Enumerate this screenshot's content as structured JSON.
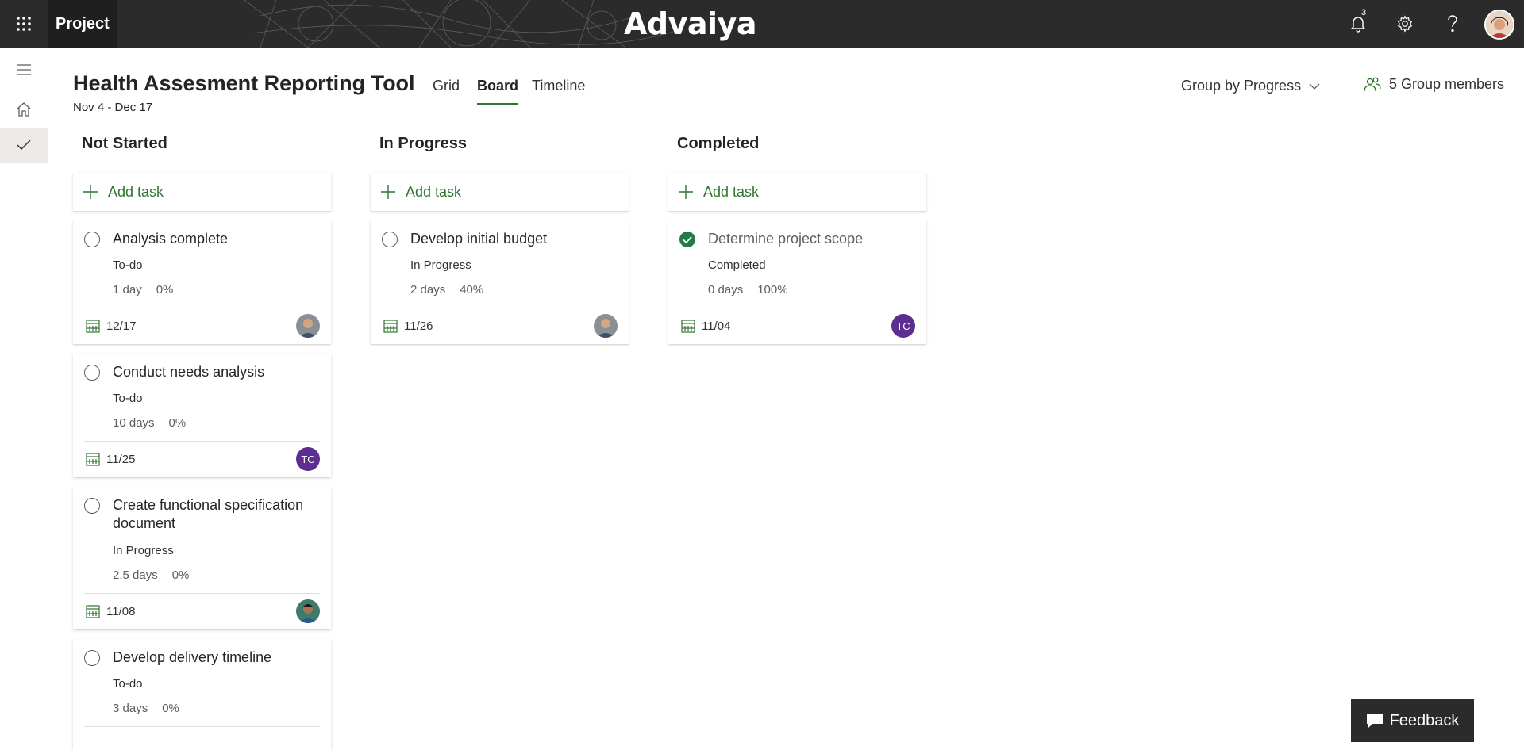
{
  "topbar": {
    "app_title": "Project",
    "brand": "Advaiya",
    "notification_count": "3",
    "icons": [
      "waffle-icon",
      "bell-icon",
      "gear-icon",
      "help-icon"
    ]
  },
  "header": {
    "title": "Health Assesment Reporting Tool",
    "dates": "Nov 4 - Dec 17",
    "tabs": [
      {
        "label": "Grid"
      },
      {
        "label": "Board"
      },
      {
        "label": "Timeline"
      }
    ],
    "active_tab": "Board",
    "group_by": "Group by Progress",
    "members": "5 Group members"
  },
  "columns": [
    {
      "title": "Not Started",
      "add_label": "Add task"
    },
    {
      "title": "In Progress",
      "add_label": "Add task"
    },
    {
      "title": "Completed",
      "add_label": "Add task"
    }
  ],
  "tasks": [
    {
      "name": "Analysis complete",
      "status": "To-do",
      "duration": "1 day",
      "percent": "0%",
      "date": "12/17",
      "assignee": "photo"
    },
    {
      "name": "Conduct needs analysis",
      "status": "To-do",
      "duration": "10 days",
      "percent": "0%",
      "date": "11/25",
      "assignee": "TC"
    },
    {
      "name": "Create functional specification document",
      "status": "In Progress",
      "duration": "2.5 days",
      "percent": "0%",
      "date": "11/08",
      "assignee": "photo"
    },
    {
      "name": "Develop delivery timeline",
      "status": "To-do",
      "duration": "3 days",
      "percent": "0%"
    },
    {
      "name": "Develop initial budget",
      "status": "In Progress",
      "duration": "2 days",
      "percent": "40%",
      "date": "11/26",
      "assignee": "photo"
    },
    {
      "name": "Determine project scope",
      "status": "Completed",
      "duration": "0 days",
      "percent": "100%",
      "date": "11/04",
      "assignee": "TC",
      "completed": true
    }
  ],
  "feedback": {
    "label": "Feedback"
  },
  "colors": {
    "accent": "#31752f",
    "topbar": "#2b2b2b",
    "avatar_tc": "#5c2e91",
    "check_done": "#237b4b"
  }
}
